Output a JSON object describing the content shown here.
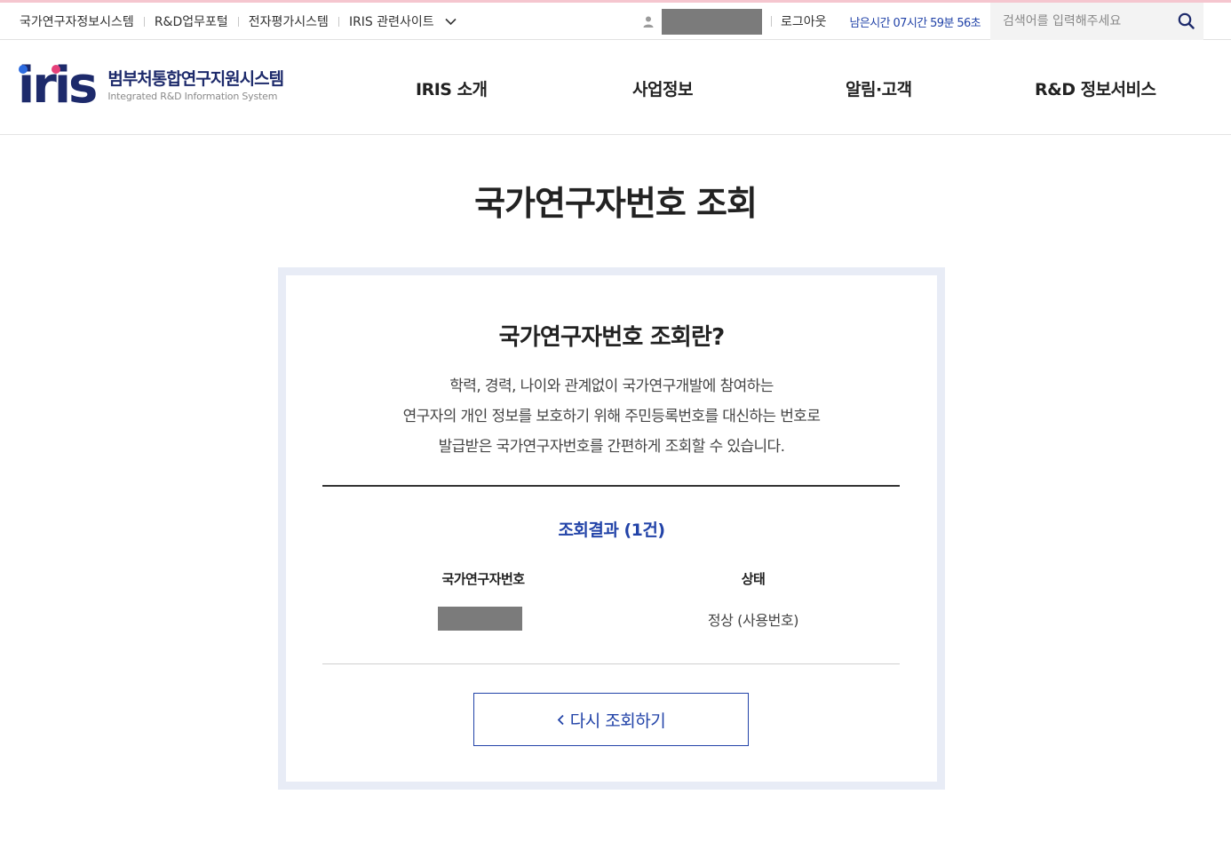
{
  "colors": {
    "brand": "#1d2a6b",
    "accent_blue": "#2243a8",
    "logo_dot_blue": "#2c6be0",
    "logo_dot_pink": "#e6407a",
    "card_border": "#e8ecf6"
  },
  "util_links": [
    {
      "label": "국가연구자정보시스템"
    },
    {
      "label": "R&D업무포털"
    },
    {
      "label": "전자평가시스템"
    },
    {
      "label": "IRIS 관련사이트",
      "icon": "chevron-down-icon"
    }
  ],
  "user": {
    "icon": "person-icon",
    "logout": "로그아웃",
    "remaining": "남은시간 07시간 59분 56초"
  },
  "search": {
    "placeholder": "검색어를 입력해주세요",
    "value": "",
    "icon": "search-icon"
  },
  "logo": {
    "mark": "iris",
    "title_ko": "범부처통합연구지원시스템",
    "title_en": "Integrated R&D Information System"
  },
  "gnb": [
    {
      "label": "IRIS 소개"
    },
    {
      "label": "사업정보"
    },
    {
      "label": "알림·고객"
    },
    {
      "label": "R&D 정보서비스"
    }
  ],
  "page_title": "국가연구자번호 조회",
  "card": {
    "heading": "국가연구자번호 조회란?",
    "desc_lines": [
      "학력, 경력, 나이와 관계없이 국가연구개발에 참여하는",
      "연구자의 개인 정보를 보호하기 위해 주민등록번호를 대신하는 번호로",
      "발급받은 국가연구자번호를 간편하게 조회할 수 있습니다."
    ],
    "result_title": "조회결과 (1건)",
    "columns": {
      "id": "국가연구자번호",
      "status": "상태"
    },
    "row": {
      "status": "정상 (사용번호)"
    },
    "retry_label": "다시 조회하기"
  }
}
